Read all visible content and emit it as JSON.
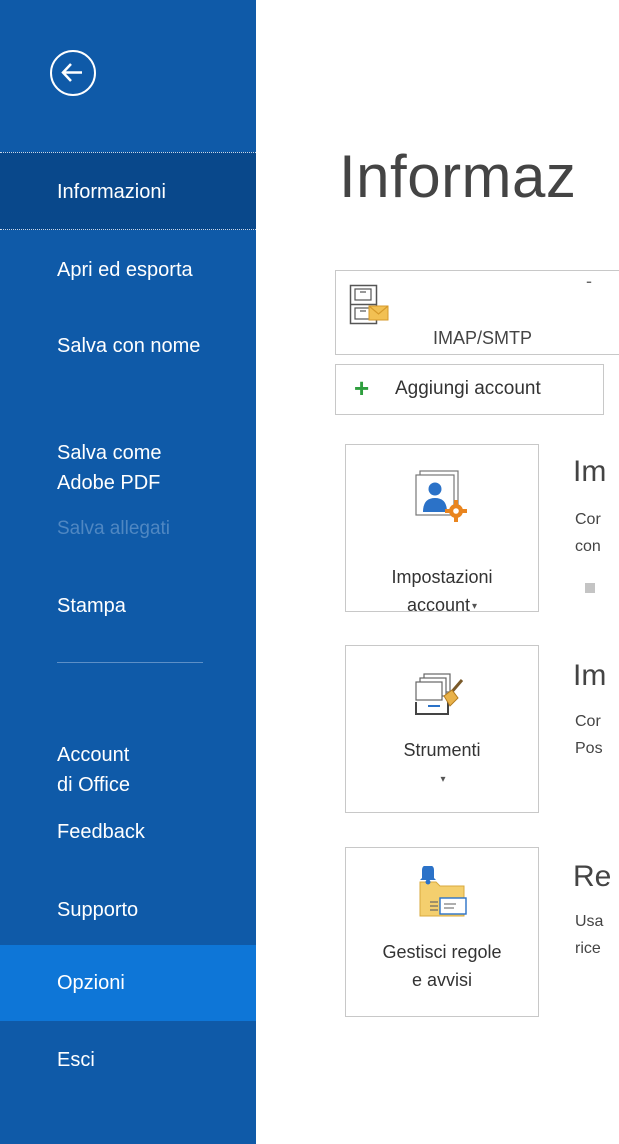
{
  "sidebar": {
    "items": [
      {
        "label": "Informazioni"
      },
      {
        "label": "Apri ed esporta"
      },
      {
        "label": "Salva con nome"
      },
      {
        "label": "Salva come\nAdobe PDF"
      },
      {
        "label": "Salva allegati"
      },
      {
        "label": "Stampa"
      },
      {
        "label": "Account\ndi Office"
      },
      {
        "label": "Feedback"
      },
      {
        "label": "Supporto"
      },
      {
        "label": "Opzioni"
      },
      {
        "label": "Esci"
      }
    ]
  },
  "main": {
    "title": "Informaz",
    "account": {
      "type": "IMAP/SMTP",
      "dash": "-"
    },
    "add_account": "Aggiungi account",
    "tiles": [
      {
        "label": "Impostazioni\naccount",
        "caret": "▾",
        "section_title": "Im",
        "section_desc": "Cor\ncon"
      },
      {
        "label": "Strumenti",
        "caret": "▾",
        "section_title": "Im",
        "section_desc": "Cor\nPos"
      },
      {
        "label": "Gestisci regole\ne avvisi",
        "section_title": "Re",
        "section_desc": "Usa\nrice"
      }
    ]
  },
  "colors": {
    "sidebar_bg": "#0f5aa8",
    "sidebar_active": "#09488b",
    "sidebar_hover": "#0e76d7",
    "add_plus": "#2e9e3e",
    "icon_orange": "#e9851f",
    "icon_blue": "#2b72c8"
  }
}
